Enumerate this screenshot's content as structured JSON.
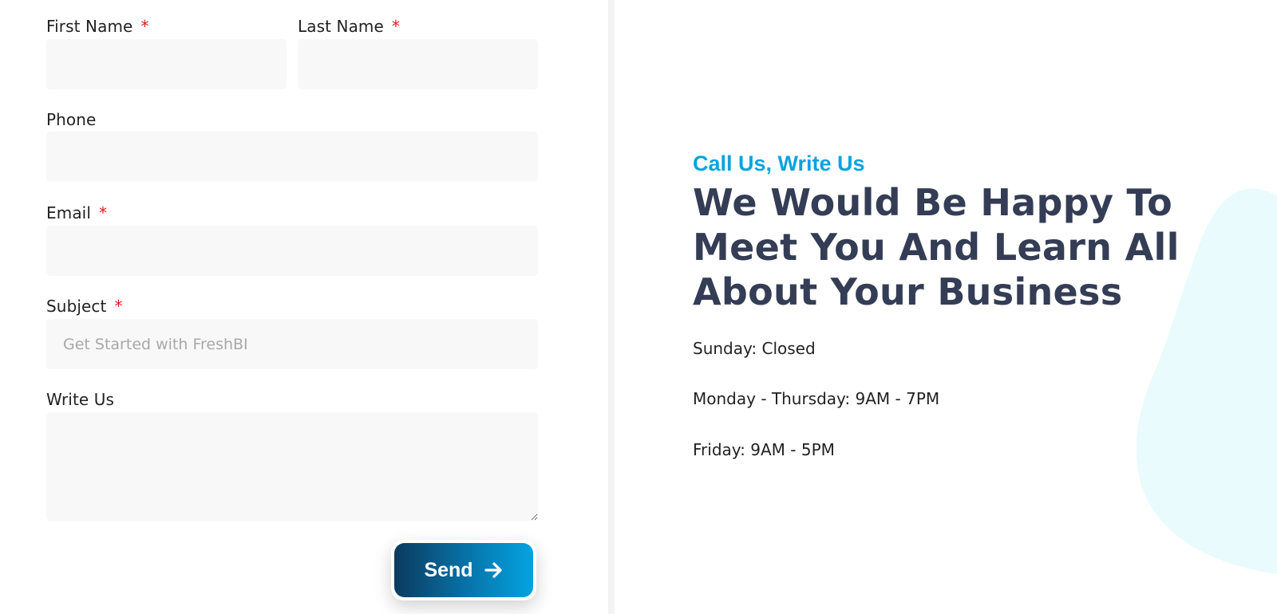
{
  "form": {
    "first_name": {
      "label": "First Name",
      "required_mark": "*",
      "value": ""
    },
    "last_name": {
      "label": "Last Name",
      "required_mark": "*",
      "value": ""
    },
    "phone": {
      "label": "Phone",
      "value": ""
    },
    "email": {
      "label": "Email",
      "required_mark": "*",
      "value": ""
    },
    "subject": {
      "label": "Subject",
      "required_mark": "*",
      "placeholder": "Get Started with FreshBI"
    },
    "message": {
      "label": "Write Us",
      "value": ""
    },
    "send_button": {
      "label": "Send",
      "icon": "arrow-right-icon"
    }
  },
  "info": {
    "kicker": "Call Us, Write Us",
    "headline_lines": [
      "We Would Be Happy To",
      "Meet You And Learn All",
      "About Your Business"
    ],
    "hours": [
      "Sunday: Closed",
      "Monday - Thursday: 9AM - 7PM",
      "Friday: 9AM - 5PM"
    ]
  },
  "colors": {
    "accent": "#0aa3dd",
    "headline": "#343d55",
    "required": "#e31b1b",
    "field_bg": "#f8f8f8",
    "blob": "#e9fbfc"
  }
}
